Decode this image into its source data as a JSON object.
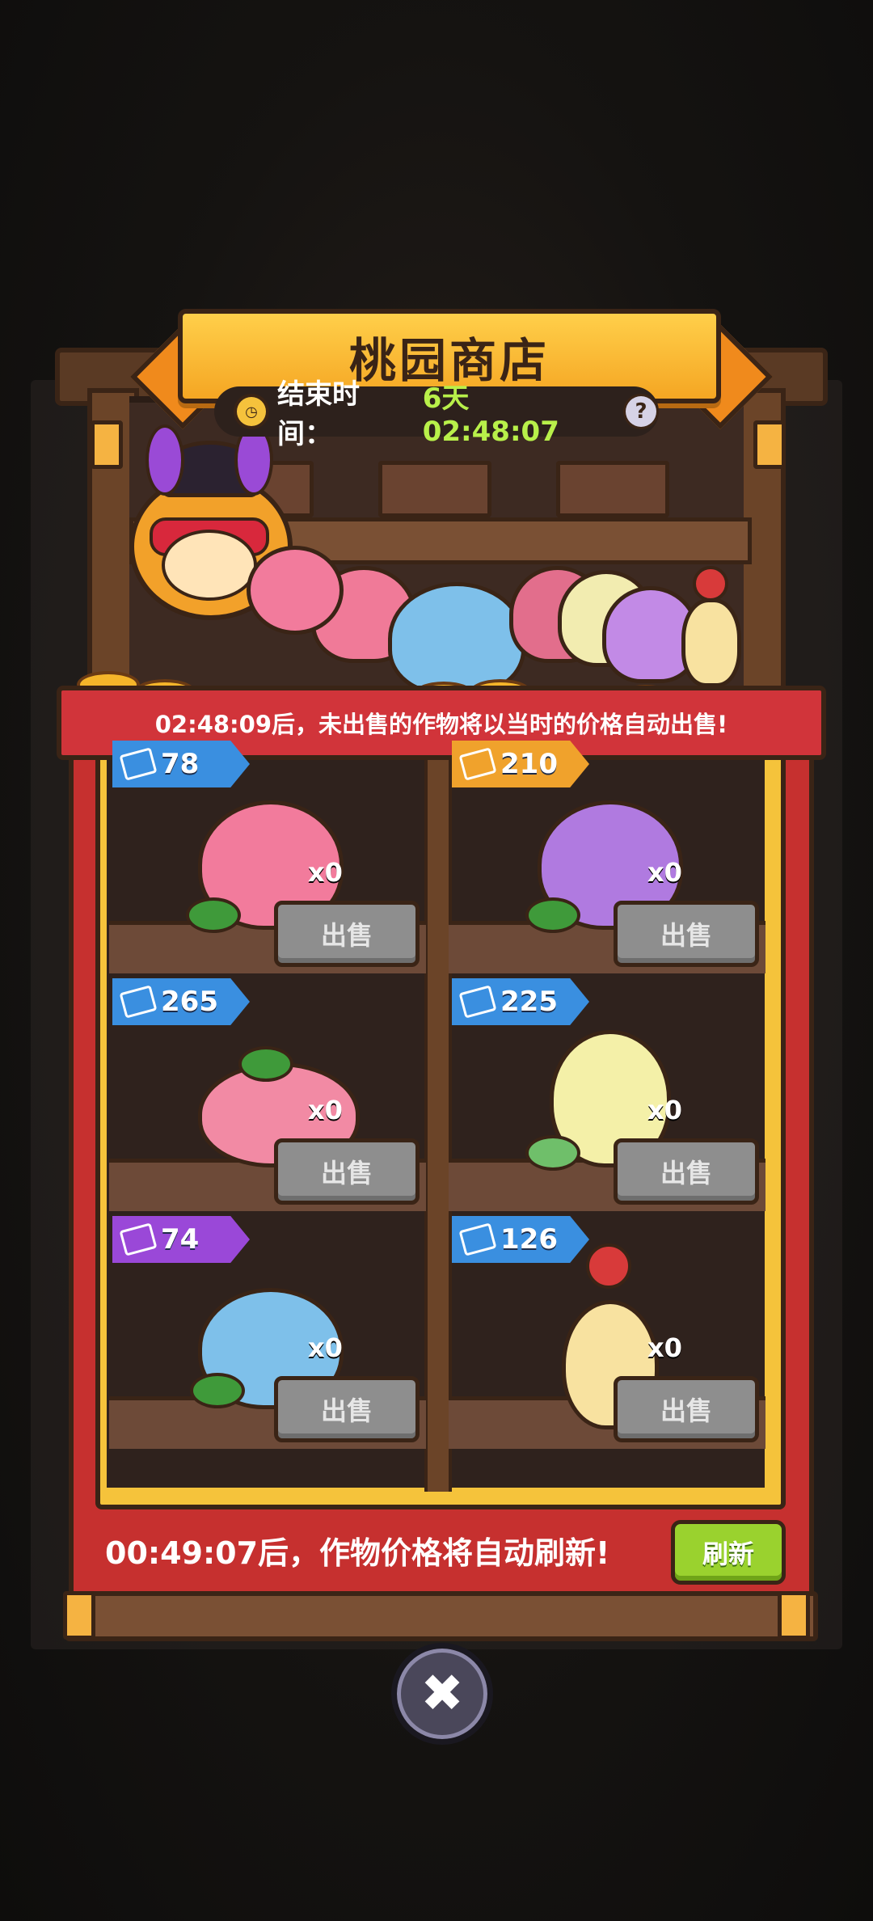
{
  "shop": {
    "title": "桃园商店",
    "end_time_label": "结束时间：",
    "end_time_value": "6天 02:48:07",
    "help_icon": "?",
    "auto_sell_notice": "02:48:09后，未出售的作物将以当时的价格自动出售!",
    "refresh_notice": "00:49:07后，作物价格将自动刷新!",
    "refresh_button": "刷新",
    "close_icon": "✖"
  },
  "items": [
    {
      "price": "78",
      "qty": "x0",
      "sell": "出售",
      "tag": "blue",
      "crop": "peach",
      "color": "#f27b9c"
    },
    {
      "price": "210",
      "qty": "x0",
      "sell": "出售",
      "tag": "orange",
      "crop": "purple-peach",
      "color": "#b07ae0"
    },
    {
      "price": "265",
      "qty": "x0",
      "sell": "出售",
      "tag": "blue",
      "crop": "twin-peach",
      "color": "#f28aa4"
    },
    {
      "price": "225",
      "qty": "x0",
      "sell": "出售",
      "tag": "blue",
      "crop": "yellow-cabbage",
      "color": "#f4f0a8"
    },
    {
      "price": "74",
      "qty": "x0",
      "sell": "出售",
      "tag": "purple",
      "crop": "blue-cabbage",
      "color": "#7ec0ea"
    },
    {
      "price": "126",
      "qty": "x0",
      "sell": "出售",
      "tag": "blue",
      "crop": "ginseng",
      "color": "#f8e2a0"
    }
  ],
  "colors": {
    "accent_gold": "#f5c33b",
    "cabinet_red": "#c6302f",
    "timer_green": "#b8f04a",
    "refresh_green": "#9ad22e"
  }
}
